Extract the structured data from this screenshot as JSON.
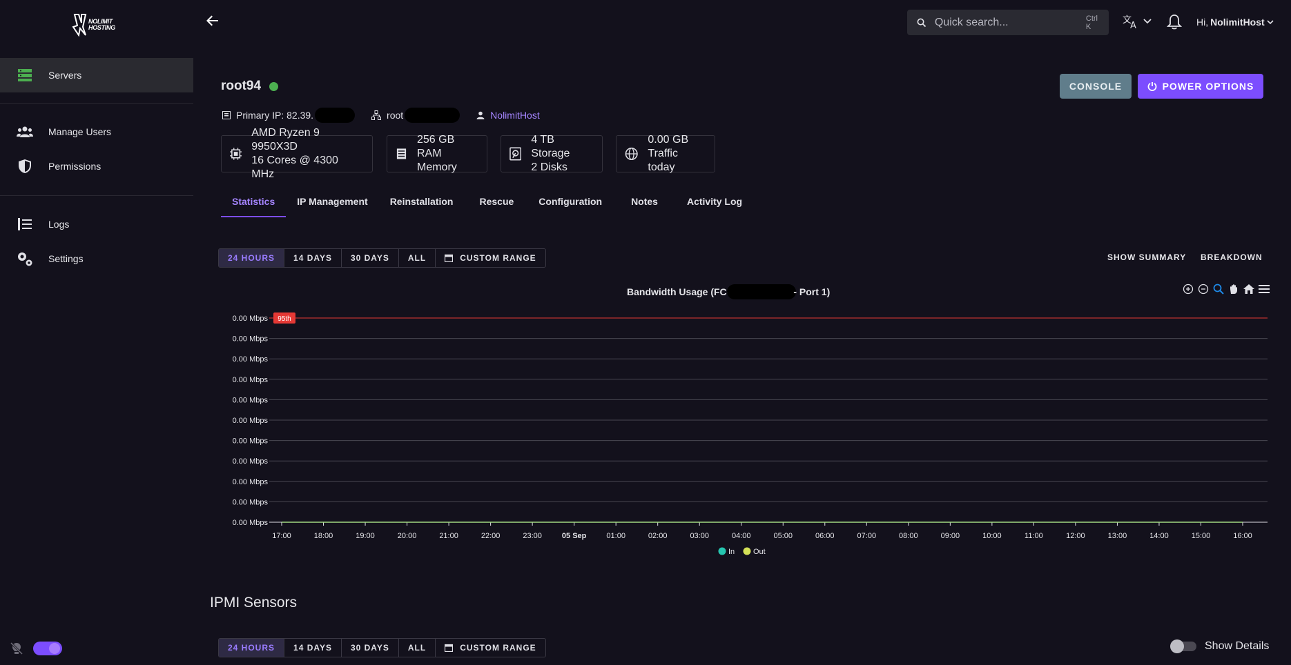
{
  "brand": {
    "logo_line1": "NOLIMIT",
    "logo_line2": "HOSTING"
  },
  "sidebar": {
    "items": [
      {
        "label": "Servers",
        "icon": "server-icon",
        "active": true
      },
      {
        "label": "Manage Users",
        "icon": "users-icon"
      },
      {
        "label": "Permissions",
        "icon": "shield-icon"
      },
      {
        "label": "Logs",
        "icon": "list-icon"
      },
      {
        "label": "Settings",
        "icon": "gears-icon"
      }
    ]
  },
  "topbar": {
    "search_placeholder": "Quick search...",
    "search_shortcut": "Ctrl K",
    "greeting_prefix": "Hi,",
    "user_name": "NolimitHost"
  },
  "server": {
    "name": "root94",
    "status": "online",
    "primary_ip": "Primary IP: 82.39.",
    "hostname": "root",
    "owner": "NolimitHost",
    "console_label": "CONSOLE",
    "power_label": "POWER OPTIONS"
  },
  "specs": [
    {
      "icon": "cpu-icon",
      "line1": "AMD Ryzen 9 9950X3D",
      "line2": "16 Cores @ 4300 MHz"
    },
    {
      "icon": "memory-icon",
      "line1": "256 GB RAM",
      "line2": "Memory"
    },
    {
      "icon": "disk-icon",
      "line1": "4 TB Storage",
      "line2": "2 Disks"
    },
    {
      "icon": "globe-icon",
      "line1": "0.00 GB",
      "line2": "Traffic today"
    }
  ],
  "tabs": [
    "Statistics",
    "IP Management",
    "Reinstallation",
    "Rescue",
    "Configuration",
    "Notes",
    "Activity Log"
  ],
  "ranges": [
    "24 HOURS",
    "14 DAYS",
    "30 DAYS",
    "ALL",
    "CUSTOM RANGE"
  ],
  "actions": {
    "summary": "SHOW SUMMARY",
    "breakdown": "BREAKDOWN"
  },
  "chart_data": {
    "type": "line",
    "title_left": "Bandwidth Usage (FC-",
    "title_right": "- Port 1)",
    "categories": [
      "17:00",
      "18:00",
      "19:00",
      "20:00",
      "21:00",
      "22:00",
      "23:00",
      "05 Sep",
      "01:00",
      "02:00",
      "03:00",
      "04:00",
      "05:00",
      "06:00",
      "07:00",
      "08:00",
      "09:00",
      "10:00",
      "11:00",
      "12:00",
      "13:00",
      "14:00",
      "15:00",
      "16:00"
    ],
    "y_ticks": [
      "0.00 Mbps",
      "0.00 Mbps",
      "0.00 Mbps",
      "0.00 Mbps",
      "0.00 Mbps",
      "0.00 Mbps",
      "0.00 Mbps",
      "0.00 Mbps",
      "0.00 Mbps",
      "0.00 Mbps",
      "0.00 Mbps"
    ],
    "series": [
      {
        "name": "In",
        "color": "#26c6b0",
        "values": [
          0,
          0,
          0,
          0,
          0,
          0,
          0,
          0,
          0,
          0,
          0,
          0,
          0,
          0,
          0,
          0,
          0,
          0,
          0,
          0,
          0,
          0,
          0,
          0
        ]
      },
      {
        "name": "Out",
        "color": "#d4e157",
        "values": [
          0,
          0,
          0,
          0,
          0,
          0,
          0,
          0,
          0,
          0,
          0,
          0,
          0,
          0,
          0,
          0,
          0,
          0,
          0,
          0,
          0,
          0,
          0,
          0
        ]
      }
    ],
    "annotation": {
      "label": "95th",
      "value": 0,
      "color": "#e53935"
    },
    "grid": true,
    "legend": "bottom-center"
  },
  "ipmi": {
    "title": "IPMI Sensors",
    "show_details": "Show Details"
  }
}
